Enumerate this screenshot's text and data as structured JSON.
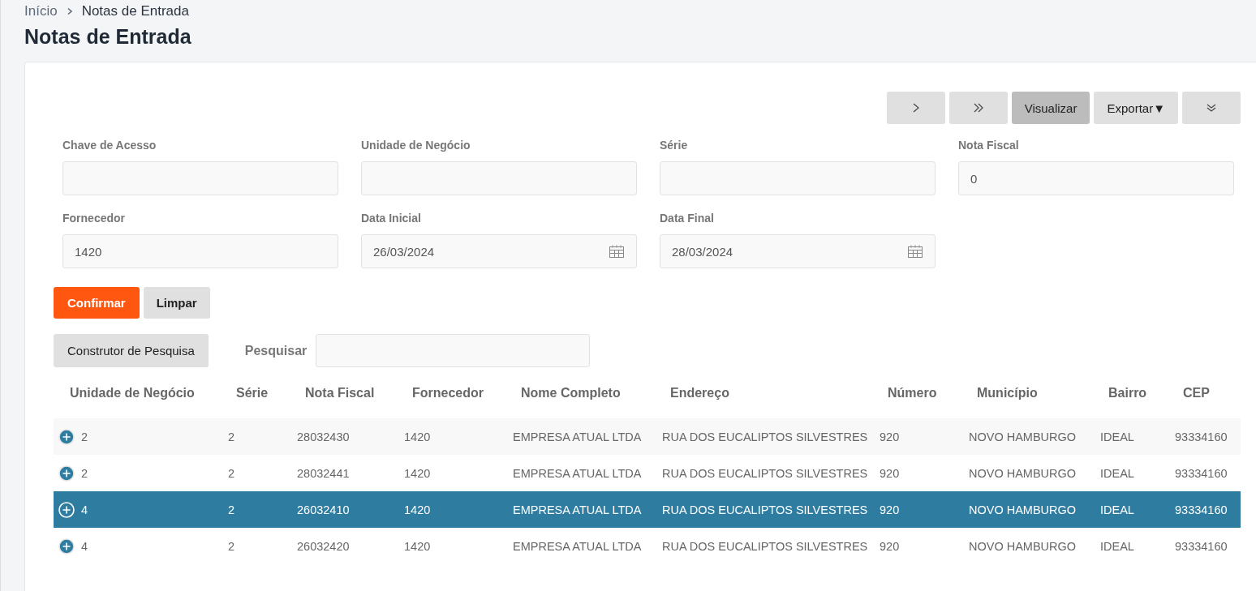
{
  "breadcrumb": [
    {
      "label": "Início"
    },
    {
      "label": "Notas de Entrada"
    }
  ],
  "title": "Notas de Entrada",
  "toolbar": [
    {
      "kind": "next"
    },
    {
      "kind": "last"
    },
    {
      "kind": "text",
      "label": "Visualizar",
      "selected": true
    },
    {
      "kind": "text",
      "label": "Exportar▼",
      "selected": false
    },
    {
      "kind": "expand"
    }
  ],
  "filters": [
    {
      "label": "Chave de Acesso",
      "kind": "text"
    },
    {
      "label": "Unidade de Negócio",
      "kind": "text"
    },
    {
      "label": "Série",
      "kind": "text"
    },
    {
      "label": "Nota Fiscal",
      "kind": "text",
      "value": "0"
    },
    {
      "label": "Fornecedor",
      "kind": "text",
      "value": "1420"
    },
    {
      "label": "Data Inicial",
      "kind": "date",
      "value": "26/03/2024"
    },
    {
      "label": "Data Final",
      "kind": "date",
      "value": "28/03/2024"
    }
  ],
  "actions": [
    {
      "label": "Confirmar",
      "kind": "primary"
    },
    {
      "label": "Limpar",
      "kind": "secondary"
    }
  ],
  "query_builder": "Construtor de Pesquisa",
  "search": {
    "label": "Pesquisar"
  },
  "table": {
    "columns": [
      "Unidade de Negócio",
      "Série",
      "Nota Fiscal",
      "Fornecedor",
      "Nome Completo",
      "Endereço",
      "Número",
      "Município",
      "Bairro",
      "CEP"
    ],
    "rows": [
      {
        "selected": false,
        "cells": [
          "2",
          "2",
          "28032430",
          "1420",
          "EMPRESA ATUAL LTDA",
          "RUA DOS EUCALIPTOS SILVESTRES",
          "920",
          "NOVO HAMBURGO",
          "IDEAL",
          "93334160"
        ]
      },
      {
        "selected": false,
        "cells": [
          "2",
          "2",
          "28032441",
          "1420",
          "EMPRESA ATUAL LTDA",
          "RUA DOS EUCALIPTOS SILVESTRES",
          "920",
          "NOVO HAMBURGO",
          "IDEAL",
          "93334160"
        ]
      },
      {
        "selected": true,
        "cells": [
          "4",
          "2",
          "26032410",
          "1420",
          "EMPRESA ATUAL LTDA",
          "RUA DOS EUCALIPTOS SILVESTRES",
          "920",
          "NOVO HAMBURGO",
          "IDEAL",
          "93334160"
        ]
      },
      {
        "selected": false,
        "cells": [
          "4",
          "2",
          "26032420",
          "1420",
          "EMPRESA ATUAL LTDA",
          "RUA DOS EUCALIPTOS SILVESTRES",
          "920",
          "NOVO HAMBURGO",
          "IDEAL",
          "93334160"
        ]
      }
    ]
  }
}
